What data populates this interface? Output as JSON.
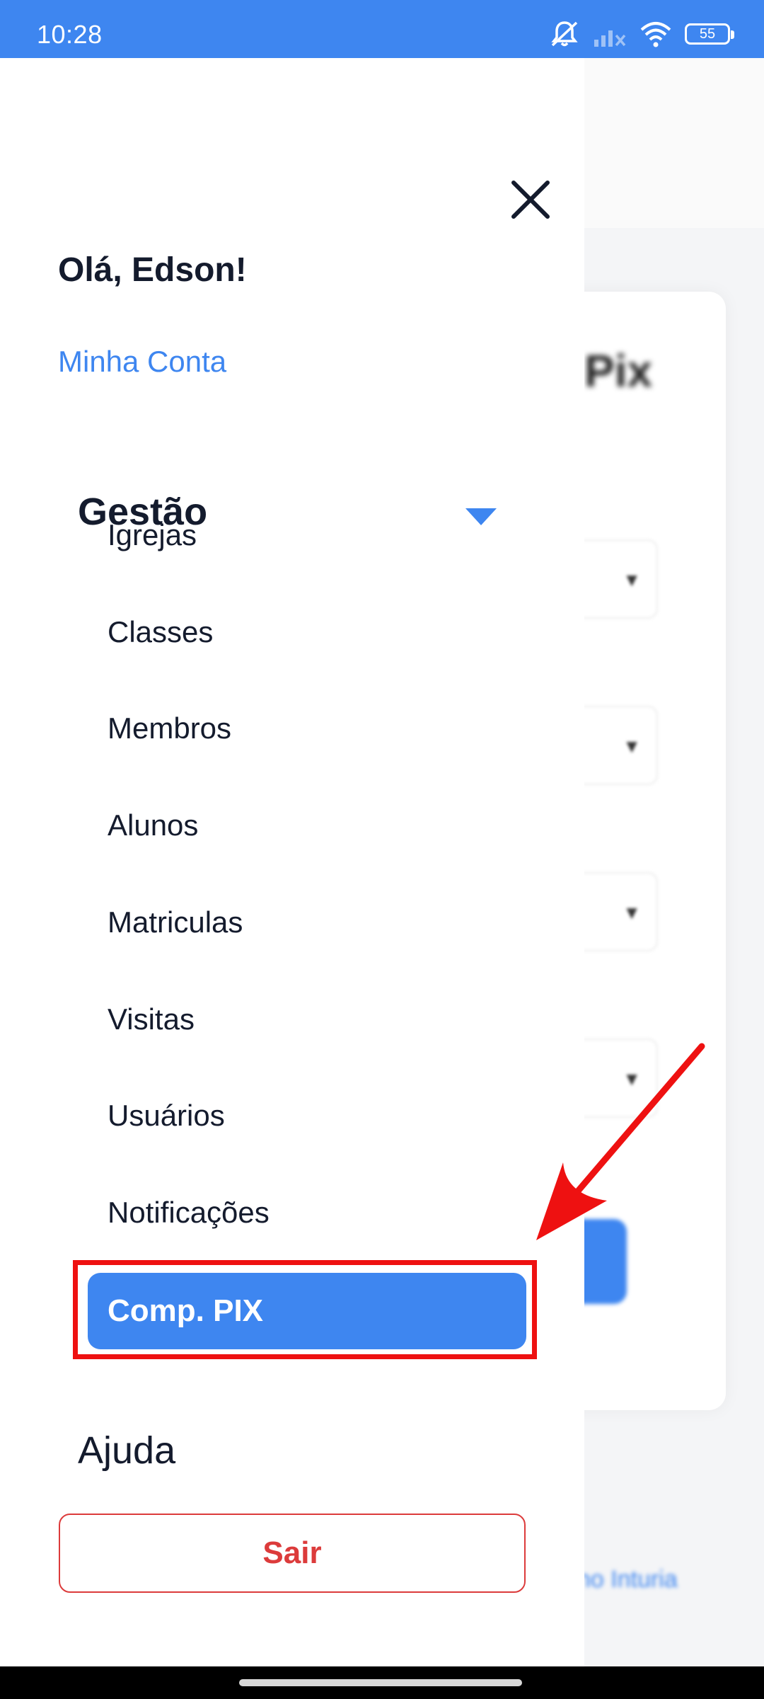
{
  "status_bar": {
    "time": "10:28",
    "battery": "55",
    "icons": [
      "mute-icon",
      "signal-icon",
      "wifi-icon",
      "battery-icon"
    ]
  },
  "background_page": {
    "title_fragment": "Pix",
    "link_fragment": "no Inturia"
  },
  "drawer": {
    "greeting": "Olá, Edson!",
    "account_link": "Minha Conta",
    "section_title": "Gestão",
    "items": [
      {
        "label": "Igrejas"
      },
      {
        "label": "Classes"
      },
      {
        "label": "Membros"
      },
      {
        "label": "Alunos"
      },
      {
        "label": "Matriculas"
      },
      {
        "label": "Visitas"
      },
      {
        "label": "Usuários"
      },
      {
        "label": "Notificações"
      }
    ],
    "active_item": "Comp. PIX",
    "help": "Ajuda",
    "logout": "Sair"
  },
  "colors": {
    "accent": "#3e86f0",
    "text": "#141b2d",
    "danger": "#dc3b3b",
    "annotation": "#ee1111"
  }
}
